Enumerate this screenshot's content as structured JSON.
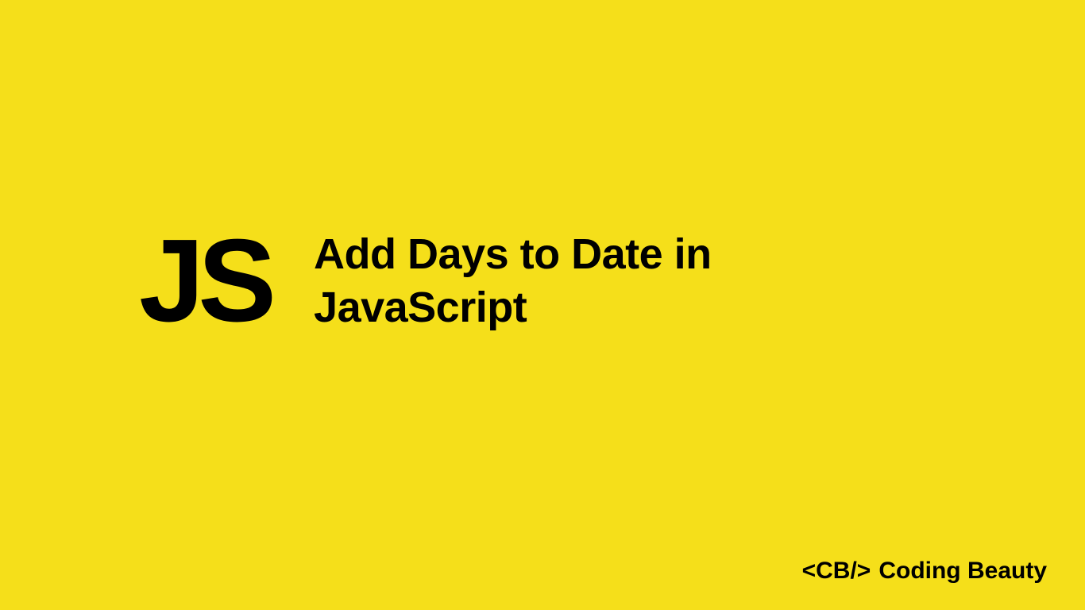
{
  "logo": {
    "text": "JS"
  },
  "title": {
    "line1": "Add Days to Date in",
    "line2": "JavaScript"
  },
  "brand": {
    "tag": "<CB/>",
    "name": "Coding Beauty"
  },
  "colors": {
    "background": "#f5df1a",
    "text": "#000000"
  }
}
